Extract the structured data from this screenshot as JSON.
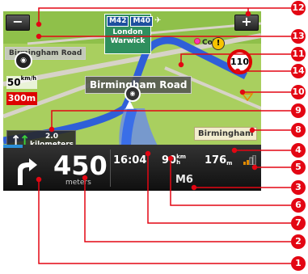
{
  "zoom": {
    "minus_label": "−",
    "plus_label": "+"
  },
  "highway_sign": {
    "shields": [
      "M42",
      "M40"
    ],
    "plane_icon": "airplane-icon",
    "destinations": [
      "London",
      "Warwick"
    ]
  },
  "streets": {
    "current": "Birmingham Road",
    "faded": "Birmingham Road",
    "next": "Birmingham"
  },
  "poi": {
    "label": "Col"
  },
  "warning": {
    "symbol": "!"
  },
  "speed_limit": {
    "value": "110"
  },
  "camera_alert": {
    "icon": "speed-camera-icon",
    "speed_value": "50",
    "speed_unit": "km/h",
    "distance": "300m"
  },
  "lane_guidance": {
    "distance_value": "2.0",
    "distance_unit": "kilometers"
  },
  "turn": {
    "distance": "450",
    "unit": "meters"
  },
  "trip": {
    "arrival_time": "16:04",
    "speed_value": "90",
    "speed_unit_top": "km",
    "speed_unit_bottom": "h",
    "remaining_value": "176",
    "remaining_unit": "m",
    "road": "M6"
  },
  "callouts": [
    "1",
    "2",
    "3",
    "4",
    "5",
    "6",
    "7",
    "8",
    "9",
    "10",
    "11",
    "12",
    "13",
    "14"
  ],
  "colors": {
    "badge": "#e30613",
    "map_green": "#a9cf5f",
    "route": "#2f5fd8",
    "speed_limit_ring": "#dd0000"
  }
}
